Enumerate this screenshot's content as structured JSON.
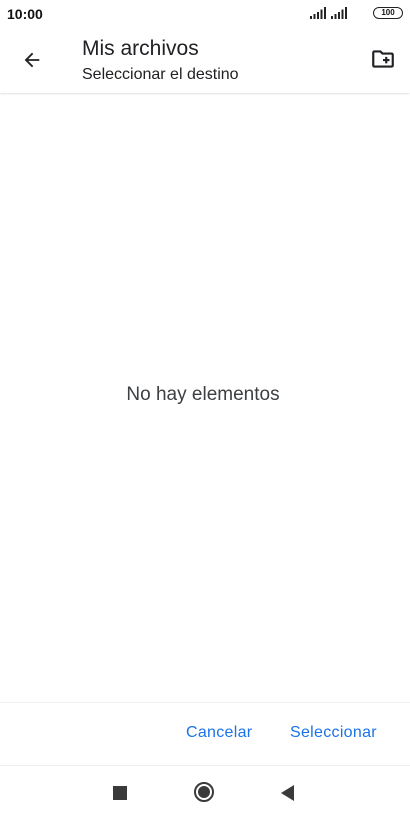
{
  "status_bar": {
    "time": "10:00",
    "battery": "100"
  },
  "app_bar": {
    "title": "Mis archivos",
    "subtitle": "Seleccionar el destino",
    "back_icon": "arrow-back-icon",
    "new_folder_icon": "create-new-folder-icon"
  },
  "content": {
    "empty_message": "No hay elementos"
  },
  "actions": {
    "cancel_label": "Cancelar",
    "select_label": "Seleccionar",
    "accent_color": "#1a73e8"
  },
  "nav_bar": {
    "recents_icon": "square-recents-icon",
    "home_icon": "circle-home-icon",
    "back_icon": "triangle-back-icon"
  }
}
